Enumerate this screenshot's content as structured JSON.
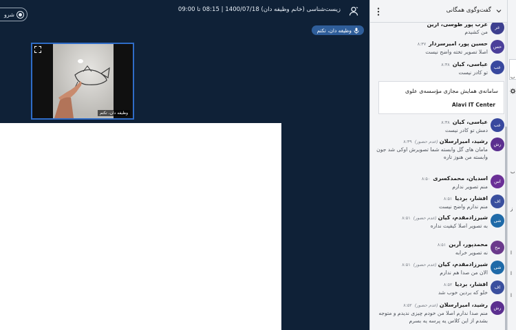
{
  "meeting": {
    "title": "زیست‌شناسی (خانم وظیفه‌ دان) 1400/07/18 | 08:15 تا 09:00",
    "record_label": "شرو",
    "presenter_chip": "وظیفه دان، تکتم"
  },
  "video": {
    "participant_name": "وظیفه دان، تکتم"
  },
  "chat": {
    "title": "گفت‌وگوی همگانی",
    "notice": {
      "title": "سامانه‌ی همایش مجازی مؤسسه‌ی علوی",
      "subtitle": "Alavi IT Center"
    },
    "messages": [
      {
        "initials": "عر",
        "color": "#3d3f8f",
        "sender": "عرب پور طوسی، آرین",
        "time": "",
        "status": "",
        "text": "من کشیدم"
      },
      {
        "initials": "حس",
        "color": "#4b3f9a",
        "sender": "حسین پور، امیرسردار",
        "time": "۸:۳۷",
        "status": "",
        "text": "اصلا تصویر تخته واضح نیست"
      },
      {
        "initials": "عب",
        "color": "#38489e",
        "sender": "عباسی، کیان",
        "time": "۸:۳۸",
        "status": "",
        "text": "تو کادر نیست"
      },
      {
        "initials": "عب",
        "color": "#38489e",
        "sender": "عباسی، کیان",
        "time": "۸:۳۸",
        "status": "",
        "text": "دمش تو کادر نیست"
      },
      {
        "initials": "رش",
        "color": "#5b2f8f",
        "sender": "رشید، امیرارسلان",
        "time": "۸:۳۹",
        "status": "(عدم حضور)",
        "text": "مامان های گل وابسته شما تصویرش اوکی شد جون وابسته من هنوز تاره"
      },
      {
        "initials": "اس",
        "color": "#6a2f96",
        "sender": "اسدیان، محمدکسری",
        "time": "۸:۵۰",
        "status": "",
        "text": "منم تصویر ندارم"
      },
      {
        "initials": "اف",
        "color": "#3a4f9e",
        "sender": "افشار، بردیا",
        "time": "۸:۵۱",
        "status": "",
        "text": "منم ندارم واضح نیست"
      },
      {
        "initials": "شی",
        "color": "#1f6aa8",
        "sender": "شیرزادمقدم، کیان",
        "time": "۸:۵۱",
        "status": "(عدم حضور)",
        "text": "به تصویر اصلا کیفیت نداره"
      },
      {
        "initials": "مح",
        "color": "#6b3a8c",
        "sender": "محمدپور، آرین",
        "time": "۸:۵۱",
        "status": "",
        "text": "نه تصویر خرابه"
      },
      {
        "initials": "شی",
        "color": "#1f6aa8",
        "sender": "شیرزادمقدم، کیان",
        "time": "۸:۵۱",
        "status": "(عدم حضور)",
        "text": "الان من صدا هم ندارم"
      },
      {
        "initials": "اف",
        "color": "#3a4f9e",
        "sender": "افشار، بردیا",
        "time": "۸:۵۲",
        "status": "",
        "text": "خلو که بردین خوب شد"
      },
      {
        "initials": "رش",
        "color": "#5b2f8f",
        "sender": "رشید، امیرارسلان",
        "time": "۸:۵۲",
        "status": "(عدم حضور)",
        "text": "منم صدا ندارم اصلا من خودم چیزی ندیدم و متوجه بشدم از این کلاس یه پرسه یه بسرم"
      }
    ]
  },
  "strip": {
    "glyphs": [
      "ب",
      "ب",
      "ز",
      "ا",
      "ا",
      "ا"
    ]
  },
  "colors": {
    "stage_bg": "#0f2137",
    "accent": "#2f6cc7",
    "chat_bg": "#f3f4f6"
  }
}
